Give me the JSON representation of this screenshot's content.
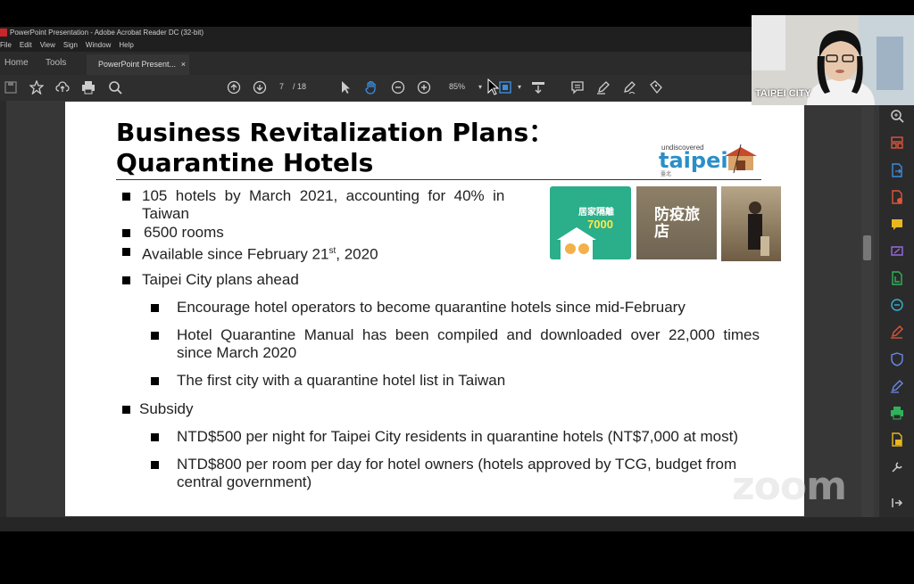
{
  "window": {
    "title": "PowerPoint Presentation - Adobe Acrobat Reader DC (32-bit)",
    "menu": [
      "File",
      "Edit",
      "View",
      "Sign",
      "Window",
      "Help"
    ]
  },
  "tabs": {
    "home": "Home",
    "tools": "Tools",
    "document": "PowerPoint Present..."
  },
  "toolbar": {
    "page_current": "7",
    "page_total": "/ 18",
    "zoom": "85%"
  },
  "slide": {
    "title_line1": "Business Revitalization Plans：",
    "title_line2": "Quarantine Hotels",
    "logo_small": "undiscovered",
    "logo_big": "taipei",
    "logo_sub": "臺北",
    "bullets": {
      "b1_line1": "105  hotels  by  March  2021,  accounting  for  40%  in",
      "b1_line2": "Taiwan",
      "b2": "6500 rooms",
      "b3_pre": "Available since February 21",
      "b3_sup": "st",
      "b3_post": ", 2020",
      "b4": "Taipei City plans ahead",
      "b4_1": "Encourage hotel operators to become quarantine hotels since mid-February",
      "b4_2_line1": "Hotel  Quarantine  Manual  has  been  compiled  and  downloaded  over  22,000  times",
      "b4_2_line2": "since March 2020",
      "b4_3": "The first city with a quarantine hotel list in Taiwan",
      "b5": "Subsidy",
      "b5_1": "NTD$500 per night for Taipei City residents in quarantine hotels (NT$7,000 at most)",
      "b5_2_line1": "NTD$800 per room per day for hotel owners (hotels approved by TCG, budget from",
      "b5_2_line2": "central government)"
    },
    "poster_text": "居家隔離",
    "poster_number": "7000",
    "photo2_text": "防疫旅店"
  },
  "webcam": {
    "label": "TAIPEI CITY"
  },
  "watermark": "zoom",
  "colors": {
    "acrobat_dark": "#2e2e2e",
    "icon_accent": "#c8252c",
    "taipei_green": "#2bae8a"
  }
}
